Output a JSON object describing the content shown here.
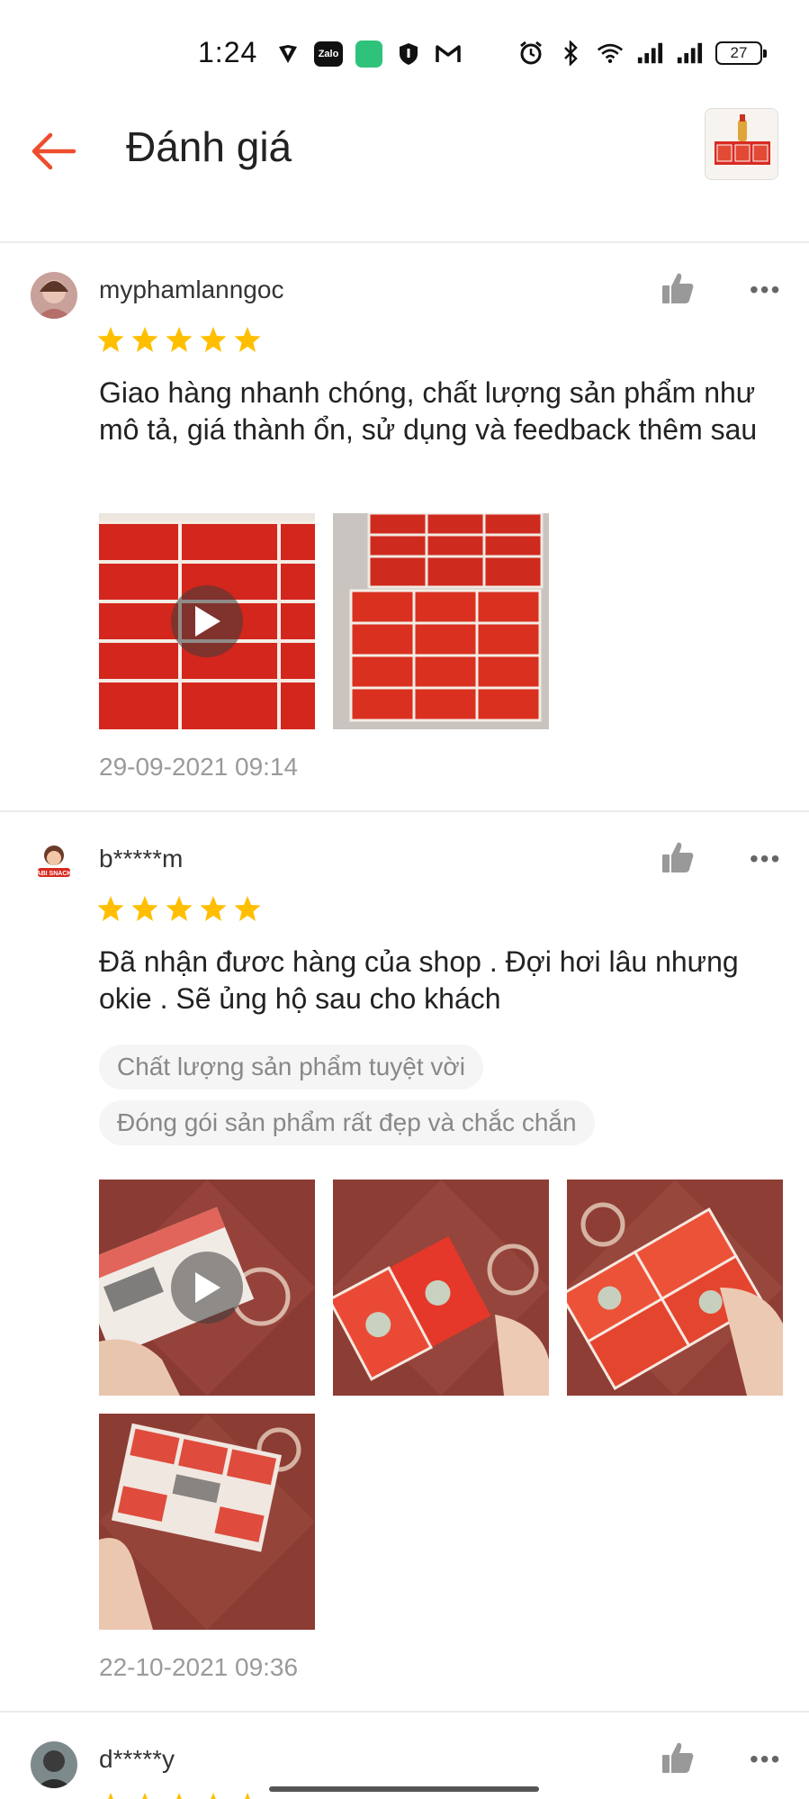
{
  "status_bar": {
    "time": "1:24",
    "left_icons": [
      "shield-icon",
      "zalo-icon",
      "app-icon",
      "privacy-icon",
      "gmail-icon"
    ],
    "zalo_label": "Zalo",
    "right_icons": [
      "alarm-icon",
      "bluetooth-icon",
      "wifi-icon",
      "signal-icon",
      "signal-icon-2"
    ],
    "battery": "27"
  },
  "header": {
    "title": "Đánh giá",
    "back_icon": "back-arrow-icon",
    "accent": "#ee4d2d"
  },
  "reviews": [
    {
      "username": "myphamlanngoc",
      "rating": 5,
      "comment": "Giao hàng nhanh chóng, chất lượng sản phẩm như mô tả, giá thành ổn, sử dụng và feedback thêm sau",
      "tags": [],
      "media": [
        {
          "type": "video"
        },
        {
          "type": "image"
        }
      ],
      "date": "29-09-2021 09:14"
    },
    {
      "username": "b*****m",
      "avatar_text": "ABI SNACK",
      "rating": 5,
      "comment": "Đã nhận đươc hàng của shop . Đợi hơi lâu nhưng okie . Sẽ ủng hộ sau cho khách",
      "tags": [
        "Chất lượng sản phẩm tuyệt vời",
        "Đóng gói sản phẩm rất đẹp và chắc chắn"
      ],
      "media": [
        {
          "type": "video"
        },
        {
          "type": "image"
        },
        {
          "type": "image"
        },
        {
          "type": "image"
        }
      ],
      "date": "22-10-2021 09:36"
    },
    {
      "username": "d*****y",
      "rating": 5
    }
  ],
  "colors": {
    "star": "#ffbf00",
    "accent": "#ee4d2d",
    "product_red": "#d92b22"
  }
}
